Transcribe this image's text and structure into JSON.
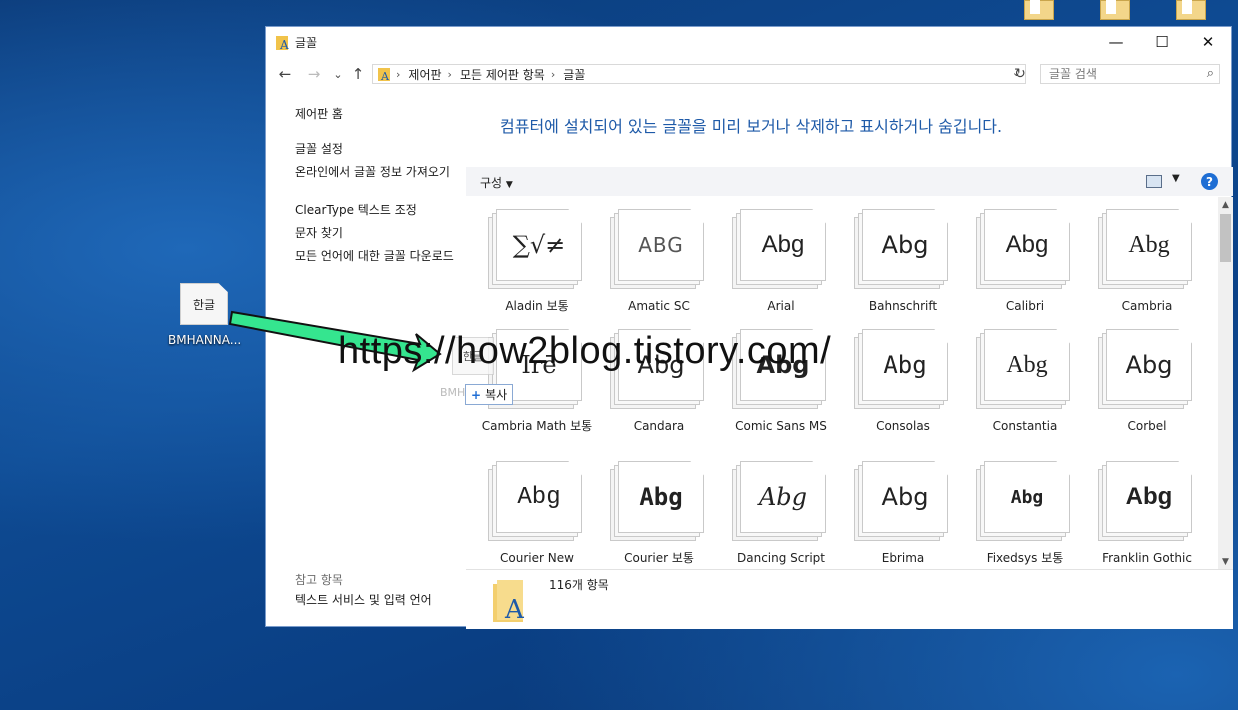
{
  "window": {
    "title": "글꼴",
    "controls": {
      "minimize": "—",
      "maximize": "☐",
      "close": "✕"
    }
  },
  "nav": {
    "back": "←",
    "forward": "→",
    "recent": "⌄",
    "up": "↑",
    "breadcrumb": [
      "제어판",
      "모든 제어판 항목",
      "글꼴"
    ],
    "refresh": "↻",
    "search_placeholder": "글꼴 검색"
  },
  "leftpane": {
    "home": "제어판 홈",
    "tasks": [
      "글꼴 설정",
      "온라인에서 글꼴 정보 가져오기",
      "ClearType 텍스트 조정",
      "문자 찾기",
      "모든 언어에 대한 글꼴 다운로드"
    ],
    "see_also_title": "참고 항목",
    "see_also": [
      "텍스트 서비스 및 입력 언어"
    ]
  },
  "heading": "컴퓨터에 설치되어 있는 글꼴을 미리 보거나 삭제하고 표시하거나 숨깁니다.",
  "toolbar": {
    "organize": "구성",
    "help": "?"
  },
  "fonts": [
    {
      "name": "Aladin 보통",
      "preview": "∑√≠"
    },
    {
      "name": "Amatic SC",
      "preview": "ABG"
    },
    {
      "name": "Arial",
      "preview": "Abg"
    },
    {
      "name": "Bahnschrift",
      "preview": "Abg"
    },
    {
      "name": "Calibri",
      "preview": "Abg"
    },
    {
      "name": "Cambria",
      "preview": "Abg"
    },
    {
      "name": "Cambria Math 보통",
      "preview": "Irē"
    },
    {
      "name": "Candara",
      "preview": "Abg"
    },
    {
      "name": "Comic Sans MS",
      "preview": "Abg"
    },
    {
      "name": "Consolas",
      "preview": "Abg"
    },
    {
      "name": "Constantia",
      "preview": "Abg"
    },
    {
      "name": "Corbel",
      "preview": "Abg"
    },
    {
      "name": "Courier New",
      "preview": "Abg"
    },
    {
      "name": "Courier 보통",
      "preview": "Abg"
    },
    {
      "name": "Dancing Script",
      "preview": "Abg"
    },
    {
      "name": "Ebrima",
      "preview": "Abg"
    },
    {
      "name": "Fixedsys 보통",
      "preview": "Abg"
    },
    {
      "name": "Franklin Gothic",
      "preview": "Abg"
    }
  ],
  "details": {
    "count": "116개 항목"
  },
  "desktop": {
    "file_icon_label": "한글",
    "file_name": "BMHANNA...",
    "drag_icon_label": "한글",
    "drag_name": "BMH",
    "copy_tooltip": "복사",
    "copy_plus": "+"
  },
  "watermark": "https://how2blog.tistory.com/"
}
